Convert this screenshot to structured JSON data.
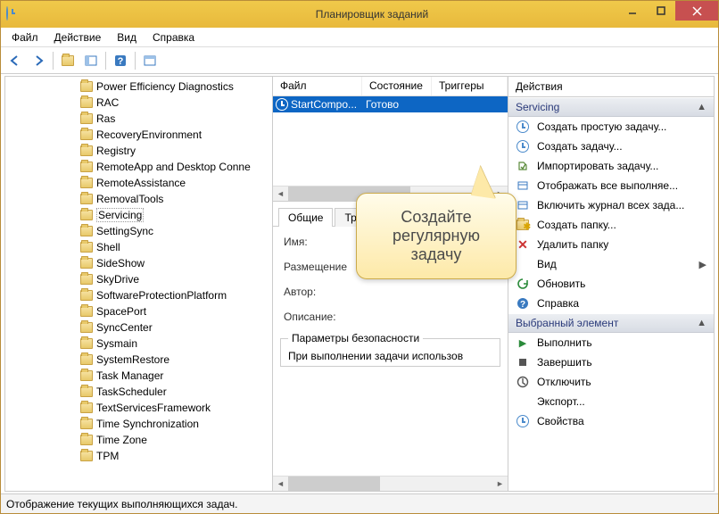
{
  "window": {
    "title": "Планировщик заданий"
  },
  "menu": {
    "file": "Файл",
    "action": "Действие",
    "view": "Вид",
    "help": "Справка"
  },
  "tree": {
    "items": [
      "Power Efficiency Diagnostics",
      "RAC",
      "Ras",
      "RecoveryEnvironment",
      "Registry",
      "RemoteApp and Desktop Conne",
      "RemoteAssistance",
      "RemovalTools",
      "Servicing",
      "SettingSync",
      "Shell",
      "SideShow",
      "SkyDrive",
      "SoftwareProtectionPlatform",
      "SpacePort",
      "SyncCenter",
      "Sysmain",
      "SystemRestore",
      "Task Manager",
      "TaskScheduler",
      "TextServicesFramework",
      "Time Synchronization",
      "Time Zone",
      "TPM"
    ],
    "selected_index": 8
  },
  "list": {
    "columns": {
      "file": "Файл",
      "state": "Состояние",
      "triggers": "Триггеры"
    },
    "rows": [
      {
        "name": "StartCompo...",
        "state": "Готово"
      }
    ]
  },
  "detail": {
    "tabs": {
      "general": "Общие",
      "tr": "Тр"
    },
    "name_label": "Имя:",
    "location_label": "Размещение",
    "author_label": "Автор:",
    "description_label": "Описание:",
    "security_group": "Параметры безопасности",
    "security_line": "При выполнении задачи использов"
  },
  "actions": {
    "header": "Действия",
    "group1": "Servicing",
    "items1": [
      "Создать простую задачу...",
      "Создать задачу...",
      "Импортировать задачу...",
      "Отображать все выполняе...",
      "Включить журнал всех зада...",
      "Создать папку...",
      "Удалить папку",
      "Вид",
      "Обновить",
      "Справка"
    ],
    "group2": "Выбранный элемент",
    "items2": [
      "Выполнить",
      "Завершить",
      "Отключить",
      "Экспорт...",
      "Свойства"
    ]
  },
  "callout": {
    "text": "Создайте регулярную задачу"
  },
  "status": {
    "text": "Отображение текущих выполняющихся задач."
  }
}
